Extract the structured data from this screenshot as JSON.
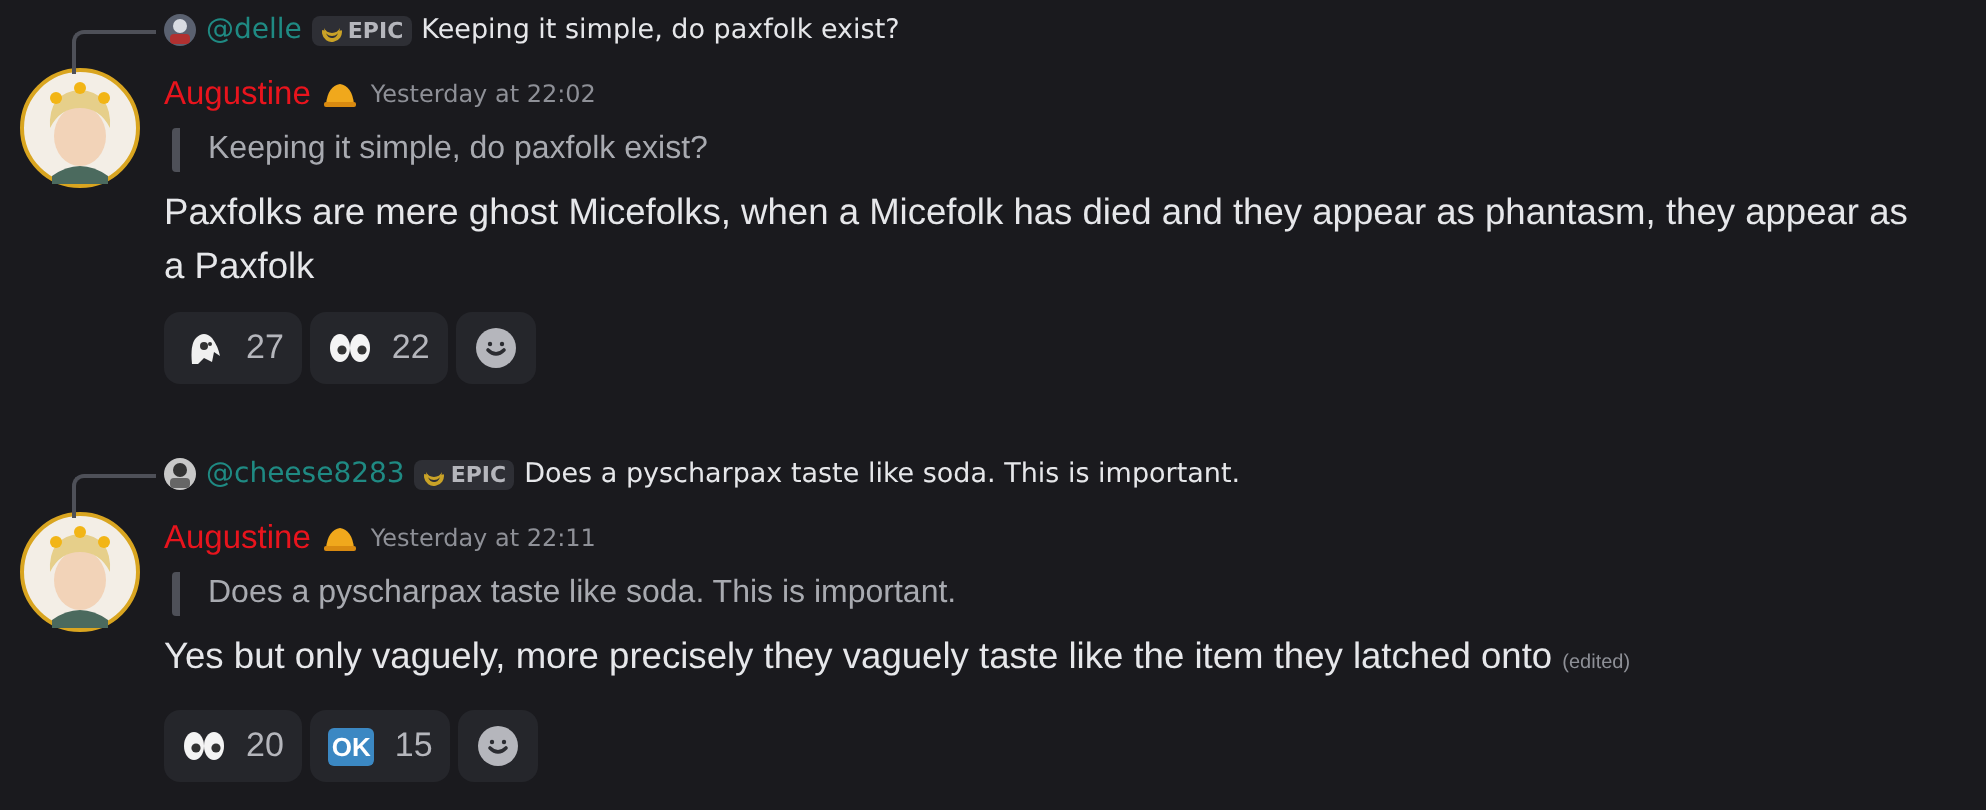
{
  "messages": [
    {
      "reply": {
        "username": "@delle",
        "tag": "EPIC",
        "text": "Keeping it simple, do paxfolk exist?"
      },
      "author": "Augustine",
      "timestamp": "Yesterday at 22:02",
      "quote": "Keeping it simple, do paxfolk exist?",
      "body": "Paxfolks are mere ghost Micefolks, when a Micefolk has died and they appear as phantasm, they appear as a Paxfolk",
      "reactions": [
        {
          "kind": "ghost",
          "count": "27"
        },
        {
          "kind": "eyes",
          "count": "22"
        },
        {
          "kind": "add"
        }
      ]
    },
    {
      "reply": {
        "username": "@cheese8283",
        "tag": "EPIC",
        "text": "Does a pyscharpax taste like soda. This is important."
      },
      "author": "Augustine",
      "timestamp": "Yesterday at 22:11",
      "quote": "Does a pyscharpax taste like soda. This is important.",
      "body": "Yes but only vaguely, more precisely they vaguely taste like the item they latched onto",
      "edited": "(edited)",
      "reactions": [
        {
          "kind": "eyes",
          "count": "20"
        },
        {
          "kind": "ok",
          "emoji_text": "OK",
          "count": "15"
        },
        {
          "kind": "add"
        }
      ]
    }
  ]
}
